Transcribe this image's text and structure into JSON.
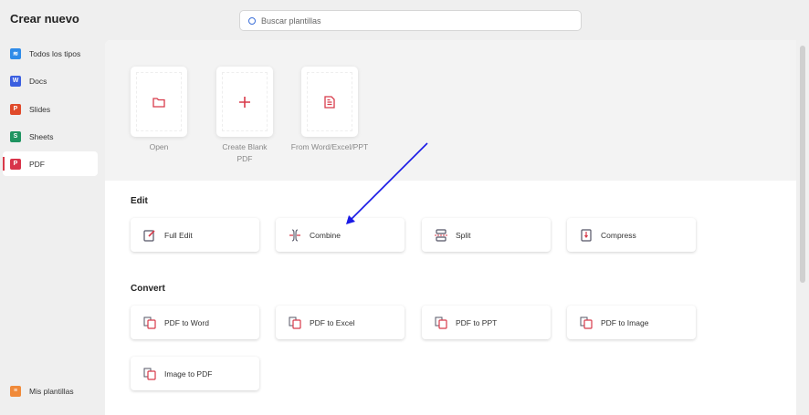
{
  "sidebar": {
    "title": "Crear nuevo",
    "items": [
      {
        "label": "Todos los tipos",
        "icon": "layers-icon",
        "color": "#2f8be8"
      },
      {
        "label": "Docs",
        "icon": "W",
        "color": "#3b5fe0"
      },
      {
        "label": "Slides",
        "icon": "P",
        "color": "#e04a2a"
      },
      {
        "label": "Sheets",
        "icon": "S",
        "color": "#1f9461"
      },
      {
        "label": "PDF",
        "icon": "P",
        "color": "#d8344a"
      }
    ],
    "footer": "Mis plantillas"
  },
  "search": {
    "placeholder": "Buscar plantillas"
  },
  "quick": [
    {
      "label": "Open"
    },
    {
      "label": "Create Blank PDF"
    },
    {
      "label": "From Word/Excel/PPT"
    }
  ],
  "edit": {
    "heading": "Edit",
    "items": [
      "Full Edit",
      "Combine",
      "Split",
      "Compress"
    ]
  },
  "convert": {
    "heading": "Convert",
    "items": [
      "PDF to Word",
      "PDF to Excel",
      "PDF to PPT",
      "PDF to Image",
      "Image to PDF"
    ]
  },
  "accent": "#d83a4a"
}
